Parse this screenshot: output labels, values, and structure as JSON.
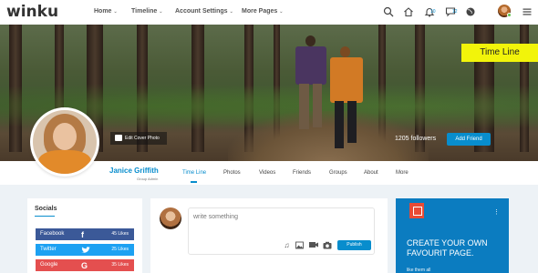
{
  "brand": {
    "logo": "winku"
  },
  "topnav": {
    "items": [
      {
        "label": "Home"
      },
      {
        "label": "Timeline"
      },
      {
        "label": "Account Settings"
      },
      {
        "label": "More Pages"
      }
    ],
    "icons": [
      "search-icon",
      "home-icon",
      "bell-icon",
      "message-icon",
      "globe-icon",
      "menu-icon"
    ],
    "notification_count": "10",
    "message_count": "12"
  },
  "cover": {
    "tag": "Time Line",
    "edit_cover_label": "Edit Cover Photo",
    "followers": "1205 followers",
    "add_friend_label": "Add Friend"
  },
  "profile": {
    "name": "Janice Griffith",
    "role": "Group Admin",
    "tabs": [
      "Time Line",
      "Photos",
      "Videos",
      "Friends",
      "Groups",
      "About",
      "More"
    ],
    "active_tab": "Time Line"
  },
  "socials": {
    "title": "Socials",
    "rows": [
      {
        "name": "Facebook",
        "icon": "facebook-icon",
        "glyph": "f",
        "likes": "45 Likes",
        "color": "#3b5998"
      },
      {
        "name": "Twitter",
        "icon": "twitter-icon",
        "glyph": "t",
        "likes": "25 Likes",
        "color": "#1da1f2"
      },
      {
        "name": "Google",
        "icon": "google-icon",
        "glyph": "G",
        "likes": "35 Likes",
        "color": "#e44f4f"
      }
    ]
  },
  "composer": {
    "placeholder": "write something",
    "publish_label": "Publish",
    "tools": [
      "music-icon",
      "image-icon",
      "video-icon",
      "camera-icon"
    ]
  },
  "ad": {
    "headline": "CREATE YOUR OWN FAVOURIT PAGE.",
    "sub": "like them all"
  },
  "colors": {
    "accent": "#088dcd",
    "ad_bg": "#0b7cc0",
    "tag_bg": "#f2f40a"
  }
}
